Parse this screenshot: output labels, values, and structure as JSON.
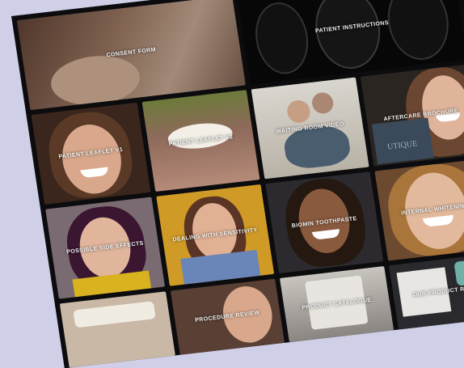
{
  "tiles": [
    {
      "label": "CONSENT FORM"
    },
    {
      "label": "PATIENT INSTRUCTIONS"
    },
    {
      "label": "PATIENT LEAFLET V1"
    },
    {
      "label": "PATIENT LEAFLET V2"
    },
    {
      "label": "WAITING ROOM VIDEO"
    },
    {
      "label": "AFTERCARE BROCHURE"
    },
    {
      "label": "POSSIBLE SIDE EFFECTS"
    },
    {
      "label": "DEALING WITH SENSITIVITY"
    },
    {
      "label": "BIOMIN TOOTHPASTE"
    },
    {
      "label": "INTERNAL WHITENING"
    },
    {
      "label": ""
    },
    {
      "label": "PROCEDURE REVIEW"
    },
    {
      "label": "PRODUCT CATALOGUE"
    },
    {
      "label": "OUR PRODUCT RANGE"
    }
  ],
  "brand_watermark": "UTIQUE"
}
